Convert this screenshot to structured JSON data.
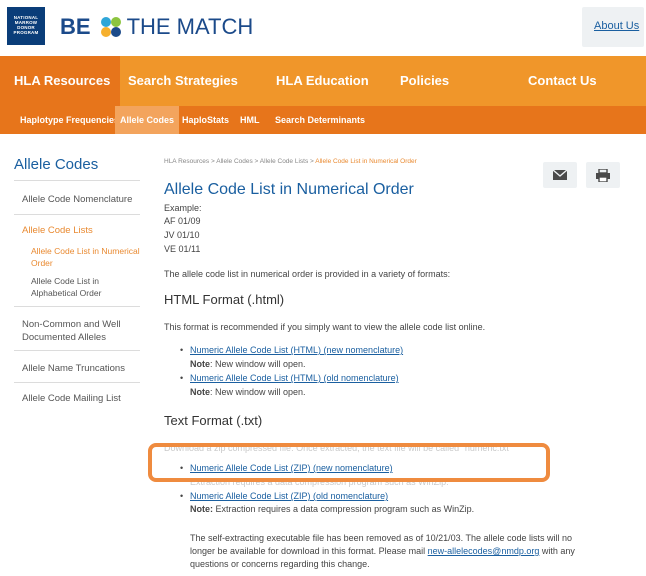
{
  "header": {
    "nmdp_logo_lines": [
      "NATIONAL",
      "MARROW",
      "DONOR",
      "PROGRAM"
    ],
    "brand_be": "BE",
    "brand_match": "THE MATCH",
    "about_link": "About Us"
  },
  "nav": {
    "items": [
      "HLA Resources",
      "Search Strategies",
      "HLA Education",
      "Policies",
      "Contact Us"
    ]
  },
  "subnav": {
    "items": [
      "Haplotype Frequencies",
      "Allele Codes",
      "HaploStats",
      "HML",
      "Search Determinants"
    ]
  },
  "sidebar": {
    "title": "Allele Codes",
    "links": [
      "Allele Code Nomenclature",
      "Allele Code Lists"
    ],
    "sub_links": [
      "Allele Code List in Numerical Order",
      "Allele Code List in Alphabetical Order"
    ],
    "more_links": [
      "Non-Common and Well Documented Alleles",
      "Allele Name Truncations",
      "Allele Code Mailing List"
    ]
  },
  "main": {
    "breadcrumb": [
      "HLA Resources",
      "Allele Codes",
      "Allele Code Lists"
    ],
    "breadcrumb_current": "Allele Code List in Numerical Order",
    "breadcrumb_sep": " > ",
    "title": "Allele Code List in Numerical Order",
    "example_label": "Example:",
    "examples": [
      "AF 01/09",
      "JV 01/10",
      "VE 01/11"
    ],
    "intro": "The allele code list in numerical order is provided in a variety of formats:",
    "html_heading": "HTML Format (.html)",
    "html_desc": "This format is recommended if you simply want to view the allele code list online.",
    "html_links": [
      "Numeric Allele Code List (HTML) (new nomenclature)",
      "Numeric Allele Code List (HTML) (old nomenclature)"
    ],
    "note_label": "Note",
    "note_new_window": ": New window will open.",
    "text_heading": "Text Format (.txt)",
    "zip_desc_faded": "Download a zip compressed file. Once extracted, the text file will be called \"numeric.txt\"",
    "zip_links": [
      "Numeric Allele Code List (ZIP) (new nomenclature)",
      "Numeric Allele Code List (ZIP) (old nomenclature)"
    ],
    "zip_note_faded": "Extraction requires a data compression program such as WinZip.",
    "zip_note_label": "Note:",
    "zip_note": " Extraction requires a data compression program such as WinZip.",
    "para_1": "The self-extracting executable file has been removed as of 10/21/03. The allele code lists will no",
    "para_2a": "longer be available for download in this format. Please mail ",
    "para_email": "new-allelecodes@nmdp.org",
    "para_2b": " with any",
    "para_3": "questions or concerns regarding this change."
  },
  "colors": {
    "nav_orange": "#f0962a",
    "nav_active": "#e7751b",
    "link_blue": "#1a5fa0",
    "accent_orange": "#e98a31",
    "highlight": "#ef8b3f"
  },
  "icons": [
    "email-icon",
    "print-icon",
    "chevron-down-icon",
    "btm-logo-icon"
  ]
}
